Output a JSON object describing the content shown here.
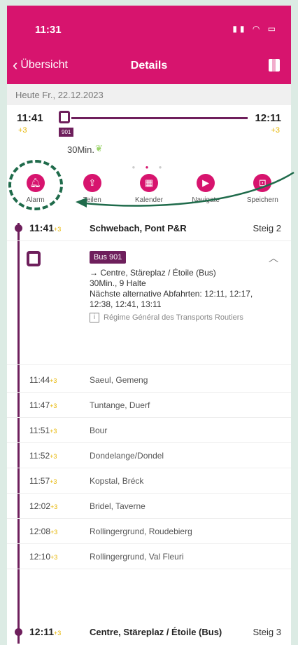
{
  "status": {
    "time": "11:31"
  },
  "nav": {
    "back_label": "Übersicht",
    "title": "Details"
  },
  "date": "Heute Fr., 22.12.2023",
  "trip": {
    "departure_time": "11:41",
    "departure_delay": "+3",
    "arrival_time": "12:11",
    "arrival_delay": "+3",
    "line": "901",
    "duration": "30Min."
  },
  "actions": [
    {
      "label": "Alarm",
      "icon": "bell-icon"
    },
    {
      "label": "Teilen",
      "icon": "share-icon"
    },
    {
      "label": "Kalender",
      "icon": "calendar-icon"
    },
    {
      "label": "Navigate",
      "icon": "play-icon"
    },
    {
      "label": "Speichern",
      "icon": "save-icon"
    }
  ],
  "origin": {
    "time": "11:41",
    "delay": "+3",
    "name": "Schwebach, Pont P&R",
    "platform": "Steig 2"
  },
  "leg": {
    "badge": "Bus 901",
    "direction": "→ Centre, Stäreplaz / Étoile (Bus)",
    "duration_stops": "30Min., 9 Halte",
    "alternatives": "Nächste alternative Abfahrten: 12:11, 12:17, 12:38, 12:41, 13:11",
    "operator": "Régime Général des Transports Routiers"
  },
  "stops": [
    {
      "time": "11:44",
      "delay": "+3",
      "name": "Saeul, Gemeng"
    },
    {
      "time": "11:47",
      "delay": "+3",
      "name": "Tuntange, Duerf"
    },
    {
      "time": "11:51",
      "delay": "+3",
      "name": "Bour"
    },
    {
      "time": "11:52",
      "delay": "+3",
      "name": "Dondelange/Dondel"
    },
    {
      "time": "11:57",
      "delay": "+3",
      "name": "Kopstal, Bréck"
    },
    {
      "time": "12:02",
      "delay": "+3",
      "name": "Bridel, Taverne"
    },
    {
      "time": "12:08",
      "delay": "+3",
      "name": "Rollingergrund, Roudebierg"
    },
    {
      "time": "12:10",
      "delay": "+3",
      "name": "Rollingergrund, Val Fleuri"
    }
  ],
  "destination": {
    "time": "12:11",
    "delay": "+3",
    "name": "Centre, Stäreplaz / Étoile (Bus)",
    "platform": "Steig 3"
  },
  "colors": {
    "brand": "#d7146e",
    "line": "#6e1f5c",
    "delay": "#e6b500",
    "annotation": "#1f6b4b"
  }
}
